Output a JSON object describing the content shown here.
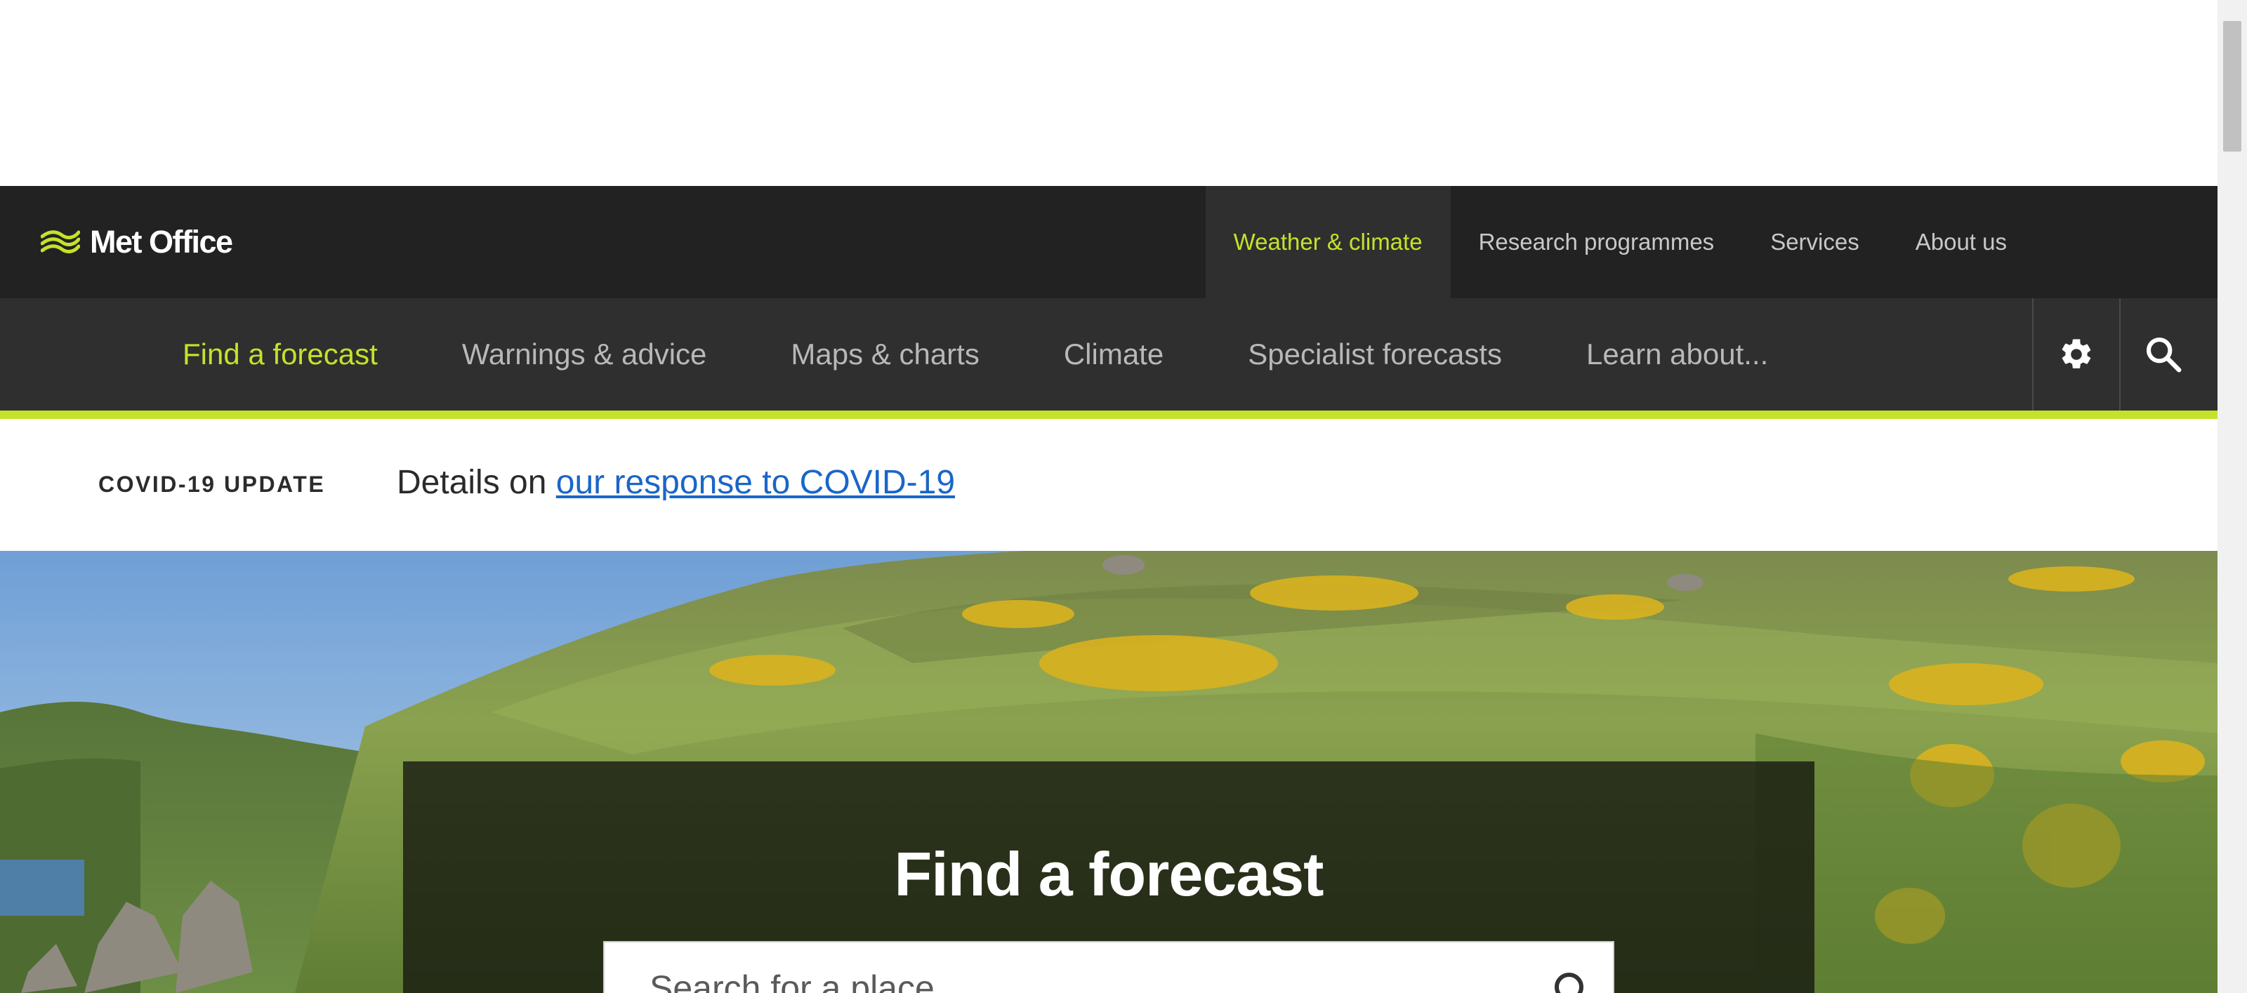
{
  "brand": {
    "name": "Met Office",
    "accent_color": "#c6e12a",
    "dark_bg": "#222222",
    "nav_bg": "#2f2f2f"
  },
  "top_nav": {
    "items": [
      {
        "label": "Weather & climate",
        "active": true
      },
      {
        "label": "Research programmes",
        "active": false
      },
      {
        "label": "Services",
        "active": false
      },
      {
        "label": "About us",
        "active": false
      }
    ]
  },
  "main_nav": {
    "items": [
      {
        "label": "Find a forecast",
        "active": true
      },
      {
        "label": "Warnings & advice",
        "active": false
      },
      {
        "label": "Maps & charts",
        "active": false
      },
      {
        "label": "Climate",
        "active": false
      },
      {
        "label": "Specialist forecasts",
        "active": false
      },
      {
        "label": "Learn about...",
        "active": false
      }
    ],
    "icons": [
      "gear-icon",
      "search-icon"
    ]
  },
  "covid_banner": {
    "label": "COVID-19 UPDATE",
    "text": "Details on ",
    "link_text": "our response to COVID-19"
  },
  "hero": {
    "title": "Find a forecast",
    "search_placeholder": "Search for a place",
    "search_icon": "search-icon"
  }
}
